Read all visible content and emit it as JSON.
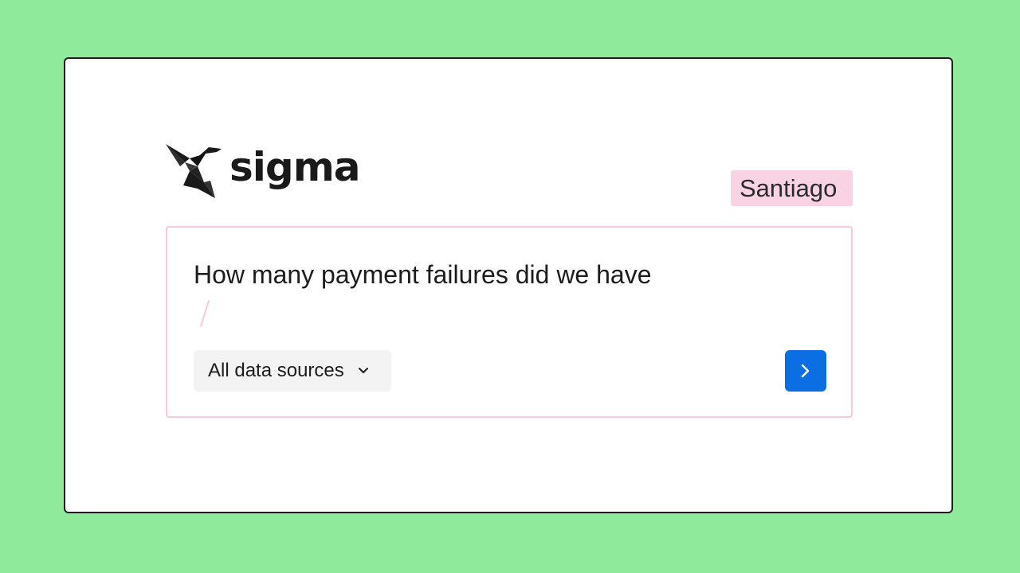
{
  "brand": {
    "name": "sigma",
    "color": "#1a1a1a"
  },
  "user": {
    "name": "Santiago",
    "badge_color": "#f9d3e3"
  },
  "ask": {
    "question": "How many payment failures did we have",
    "data_source": {
      "selected": "All data sources",
      "icon": "chevron-down-icon"
    },
    "submit_icon": "chevron-right-icon",
    "accent_color": "#0b6ee3",
    "card_border_color": "#f5c9df"
  },
  "colors": {
    "background": "#8fea9c",
    "panel": "#ffffff"
  }
}
